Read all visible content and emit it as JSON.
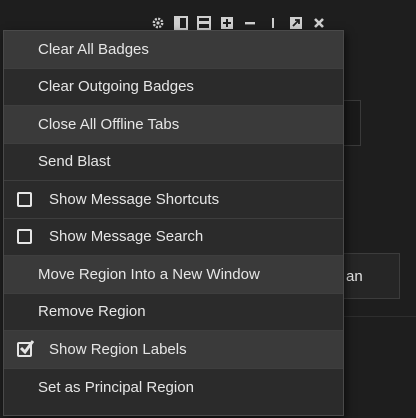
{
  "background": {
    "button_label": "an",
    "toolbar_icons": [
      "gear-icon",
      "layout-single-icon",
      "layout-split-icon",
      "add-panel-icon",
      "minimize-icon",
      "divider-icon",
      "popout-icon",
      "close-icon"
    ]
  },
  "menu": {
    "items": [
      {
        "label": "Clear All Badges",
        "highlighted": true,
        "checkbox": null
      },
      {
        "label": "Clear Outgoing Badges",
        "highlighted": false,
        "checkbox": null
      },
      {
        "label": "Close All Offline Tabs",
        "highlighted": true,
        "checkbox": null
      },
      {
        "label": "Send Blast",
        "highlighted": false,
        "checkbox": null
      },
      {
        "label": "Show Message Shortcuts",
        "highlighted": false,
        "checkbox": "unchecked"
      },
      {
        "label": "Show Message Search",
        "highlighted": false,
        "checkbox": "unchecked"
      },
      {
        "label": "Move Region Into a New Window",
        "highlighted": true,
        "checkbox": null
      },
      {
        "label": "Remove Region",
        "highlighted": false,
        "checkbox": null
      },
      {
        "label": "Show Region Labels",
        "highlighted": true,
        "checkbox": "checked"
      },
      {
        "label": "Set as Principal Region",
        "highlighted": false,
        "checkbox": null
      }
    ]
  },
  "colors": {
    "menu_background": "#2b2b2b",
    "menu_highlight": "#3a3a3a",
    "text": "#e6e6e6",
    "window_background": "#1e1e1e"
  }
}
